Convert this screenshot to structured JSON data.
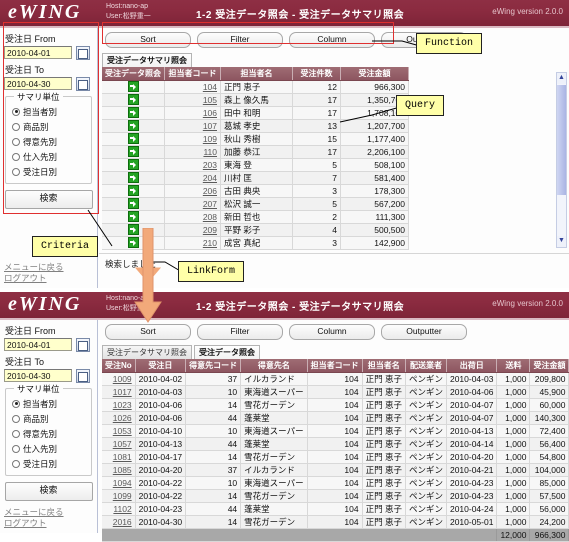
{
  "brand": {
    "logo": "eWING",
    "host_label": "Host:nano-ap",
    "user_label": "User:松野重一",
    "app_title": "1-2 受注データ照会 - 受注データサマリ照会",
    "version": "eWing version 2.0.0",
    "bar_color": "#8b2b40"
  },
  "sidebar": {
    "from_label": "受注日 From",
    "from_value": "2010-04-01",
    "to_label": "受注日 To",
    "to_value": "2010-04-30",
    "group_legend": "サマリ単位",
    "radios": [
      {
        "label": "担当者別",
        "selected": true
      },
      {
        "label": "商品別",
        "selected": false
      },
      {
        "label": "得意先別",
        "selected": false
      },
      {
        "label": "仕入先別",
        "selected": false
      },
      {
        "label": "受注日別",
        "selected": false
      }
    ],
    "search_button": "検索",
    "links": [
      "メニューに戻る",
      "ログアウト"
    ],
    "calendar_icon": "calendar-icon"
  },
  "toolbar": {
    "buttons": [
      "Sort",
      "Filter",
      "Column",
      "Outputter"
    ]
  },
  "panel1": {
    "tabs": [
      {
        "label": "受注データサマリ照会",
        "active": true
      }
    ],
    "table": {
      "columns": [
        "受注データ照会",
        "担当者コード",
        "担当者名",
        "受注件数",
        "受注金額"
      ],
      "rows": [
        {
          "link_icon": "go-arrow-icon",
          "code": "104",
          "name": "正門 恵子",
          "count": "12",
          "amount": "966,300"
        },
        {
          "link_icon": "go-arrow-icon",
          "code": "105",
          "name": "森上 像久馬",
          "count": "17",
          "amount": "1,350,700"
        },
        {
          "link_icon": "go-arrow-icon",
          "code": "106",
          "name": "田中 和明",
          "count": "17",
          "amount": "1,708,100"
        },
        {
          "link_icon": "go-arrow-icon",
          "code": "107",
          "name": "葛城 孝史",
          "count": "13",
          "amount": "1,207,700"
        },
        {
          "link_icon": "go-arrow-icon",
          "code": "109",
          "name": "秋山 秀樹",
          "count": "15",
          "amount": "1,177,400"
        },
        {
          "link_icon": "go-arrow-icon",
          "code": "110",
          "name": "加藤 恭江",
          "count": "17",
          "amount": "2,206,100"
        },
        {
          "link_icon": "go-arrow-icon",
          "code": "203",
          "name": "東海 登",
          "count": "5",
          "amount": "508,100"
        },
        {
          "link_icon": "go-arrow-icon",
          "code": "204",
          "name": "川村 匡",
          "count": "7",
          "amount": "581,400"
        },
        {
          "link_icon": "go-arrow-icon",
          "code": "206",
          "name": "古田 典央",
          "count": "3",
          "amount": "178,300"
        },
        {
          "link_icon": "go-arrow-icon",
          "code": "207",
          "name": "松沢 誠一",
          "count": "5",
          "amount": "567,200"
        },
        {
          "link_icon": "go-arrow-icon",
          "code": "208",
          "name": "新田 哲也",
          "count": "2",
          "amount": "111,300"
        },
        {
          "link_icon": "go-arrow-icon",
          "code": "209",
          "name": "平野 彩子",
          "count": "4",
          "amount": "500,500"
        },
        {
          "link_icon": "go-arrow-icon",
          "code": "210",
          "name": "成宮 真紀",
          "count": "3",
          "amount": "142,900"
        }
      ]
    },
    "status": "検索しました"
  },
  "panel2": {
    "tabs": [
      {
        "label": "受注データサマリ照会",
        "active": false
      },
      {
        "label": "受注データ照会",
        "active": true
      }
    ],
    "table": {
      "columns": [
        "受注No",
        "受注日",
        "得意先コード",
        "得意先名",
        "担当者コード",
        "担当者名",
        "配送業者",
        "出荷日",
        "送料",
        "受注金額"
      ],
      "rows": [
        {
          "no": "1009",
          "order_date": "2010-04-02",
          "cust_code": "37",
          "cust_name": "イルカランド",
          "emp_code": "104",
          "emp_name": "正門 恵子",
          "carrier": "ペンギン",
          "ship_date": "2010-04-03",
          "fee": "1,000",
          "amount": "209,800"
        },
        {
          "no": "1017",
          "order_date": "2010-04-03",
          "cust_code": "10",
          "cust_name": "東海道スーパー",
          "emp_code": "104",
          "emp_name": "正門 恵子",
          "carrier": "ペンギン",
          "ship_date": "2010-04-06",
          "fee": "1,000",
          "amount": "45,900"
        },
        {
          "no": "1023",
          "order_date": "2010-04-06",
          "cust_code": "14",
          "cust_name": "雪花ガーデン",
          "emp_code": "104",
          "emp_name": "正門 恵子",
          "carrier": "ペンギン",
          "ship_date": "2010-04-07",
          "fee": "1,000",
          "amount": "60,000"
        },
        {
          "no": "1026",
          "order_date": "2010-04-06",
          "cust_code": "44",
          "cust_name": "蓬莱堂",
          "emp_code": "104",
          "emp_name": "正門 恵子",
          "carrier": "ペンギン",
          "ship_date": "2010-04-07",
          "fee": "1,000",
          "amount": "140,300"
        },
        {
          "no": "1053",
          "order_date": "2010-04-10",
          "cust_code": "10",
          "cust_name": "東海道スーパー",
          "emp_code": "104",
          "emp_name": "正門 恵子",
          "carrier": "ペンギン",
          "ship_date": "2010-04-13",
          "fee": "1,000",
          "amount": "72,400"
        },
        {
          "no": "1057",
          "order_date": "2010-04-13",
          "cust_code": "44",
          "cust_name": "蓬莱堂",
          "emp_code": "104",
          "emp_name": "正門 恵子",
          "carrier": "ペンギン",
          "ship_date": "2010-04-14",
          "fee": "1,000",
          "amount": "56,400"
        },
        {
          "no": "1081",
          "order_date": "2010-04-17",
          "cust_code": "14",
          "cust_name": "雪花ガーデン",
          "emp_code": "104",
          "emp_name": "正門 恵子",
          "carrier": "ペンギン",
          "ship_date": "2010-04-20",
          "fee": "1,000",
          "amount": "54,800"
        },
        {
          "no": "1085",
          "order_date": "2010-04-20",
          "cust_code": "37",
          "cust_name": "イルカランド",
          "emp_code": "104",
          "emp_name": "正門 恵子",
          "carrier": "ペンギン",
          "ship_date": "2010-04-21",
          "fee": "1,000",
          "amount": "104,000"
        },
        {
          "no": "1094",
          "order_date": "2010-04-22",
          "cust_code": "10",
          "cust_name": "東海道スーパー",
          "emp_code": "104",
          "emp_name": "正門 恵子",
          "carrier": "ペンギン",
          "ship_date": "2010-04-23",
          "fee": "1,000",
          "amount": "85,000"
        },
        {
          "no": "1099",
          "order_date": "2010-04-22",
          "cust_code": "14",
          "cust_name": "雪花ガーデン",
          "emp_code": "104",
          "emp_name": "正門 恵子",
          "carrier": "ペンギン",
          "ship_date": "2010-04-23",
          "fee": "1,000",
          "amount": "57,500"
        },
        {
          "no": "1102",
          "order_date": "2010-04-23",
          "cust_code": "44",
          "cust_name": "蓬莱堂",
          "emp_code": "104",
          "emp_name": "正門 恵子",
          "carrier": "ペンギン",
          "ship_date": "2010-04-24",
          "fee": "1,000",
          "amount": "56,000"
        },
        {
          "no": "2016",
          "order_date": "2010-04-30",
          "cust_code": "14",
          "cust_name": "雪花ガーデン",
          "emp_code": "104",
          "emp_name": "正門 恵子",
          "carrier": "ペンギン",
          "ship_date": "2010-05-01",
          "fee": "1,000",
          "amount": "24,200"
        }
      ],
      "totals": {
        "fee": "12,000",
        "amount": "966,300"
      }
    }
  },
  "annotations": {
    "function": "Function",
    "query": "Query",
    "criteria": "Criteria",
    "linkform": "LinkForm",
    "box_color": "#ffffa8",
    "highlight_color": "#e03030",
    "arrow_color": "#f2a97a"
  }
}
